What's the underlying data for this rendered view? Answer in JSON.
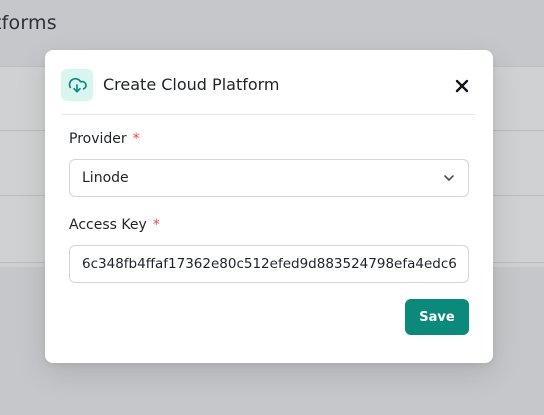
{
  "background": {
    "page_title": "tforms"
  },
  "modal": {
    "title": "Create Cloud Platform",
    "icon": "cloud-download-icon",
    "close_icon": "close-icon",
    "accent_color": "#0b8a7b",
    "icon_bg_color": "#d8f5ef"
  },
  "form": {
    "provider": {
      "label": "Provider",
      "required_mark": "*",
      "value": "Linode",
      "icon": "chevron-down-icon"
    },
    "access_key": {
      "label": "Access Key",
      "required_mark": "*",
      "value": "6c348fb4ffaf17362e80c512efed9d883524798efa4edc6"
    },
    "save_label": "Save"
  }
}
